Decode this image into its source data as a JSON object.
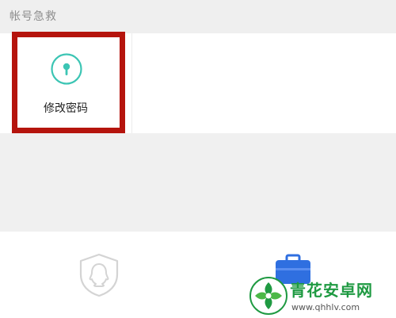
{
  "section": {
    "title": "帐号急救"
  },
  "tiles": [
    {
      "label": "修改密码",
      "icon": "key-icon"
    }
  ],
  "bottom_bar": {
    "items": [
      {
        "icon": "qq-shield-icon"
      },
      {
        "icon": "toolbox-icon"
      }
    ]
  },
  "watermark": {
    "text": "青花安卓网",
    "url": "www.qhhlv.com"
  },
  "colors": {
    "accent_teal": "#3cc5b4",
    "highlight_red": "#b5140d",
    "toolbox_blue": "#2f6fe0",
    "watermark_green": "#1f9a42"
  }
}
